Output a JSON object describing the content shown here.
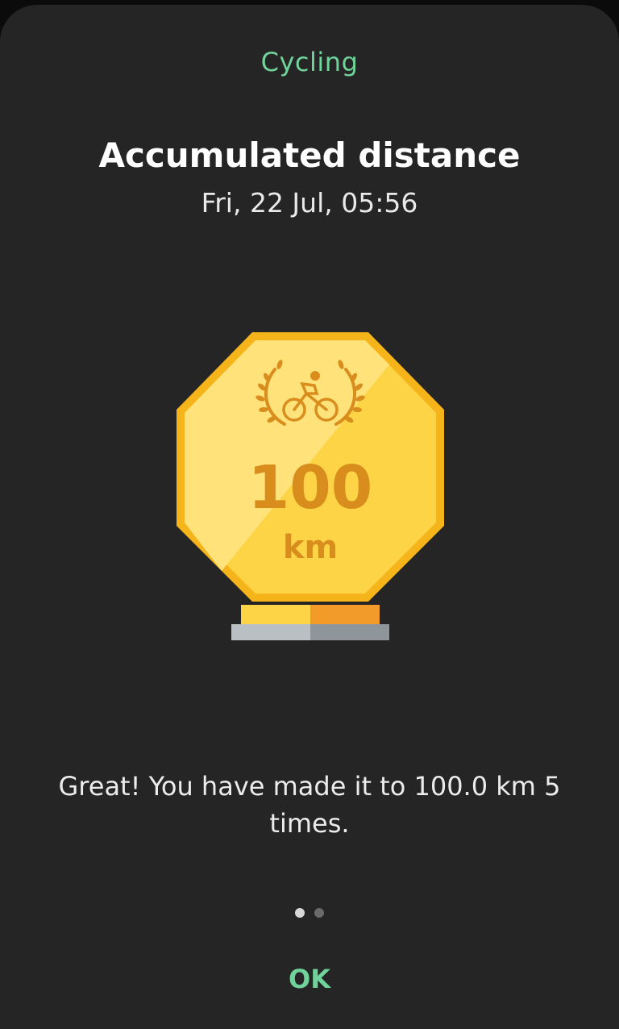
{
  "dialog": {
    "category": "Cycling",
    "title": "Accumulated distance",
    "datetime": "Fri, 22 Jul, 05:56",
    "message": "Great! You have made it to 100.0 km 5 times.",
    "ok_label": "OK"
  },
  "badge": {
    "value": "100",
    "unit": "km",
    "icon": "cyclist-laurel-icon",
    "colors": {
      "gold_light": "#ffe27a",
      "gold": "#fdd445",
      "gold_dark": "#f4b41a",
      "text": "#d88d1d",
      "base_orange": "#f29b2b",
      "base_gray": "#b9c0c4"
    }
  },
  "pager": {
    "pages": 2,
    "current": 1
  },
  "colors": {
    "accent": "#6fd39a",
    "background": "#252525"
  }
}
